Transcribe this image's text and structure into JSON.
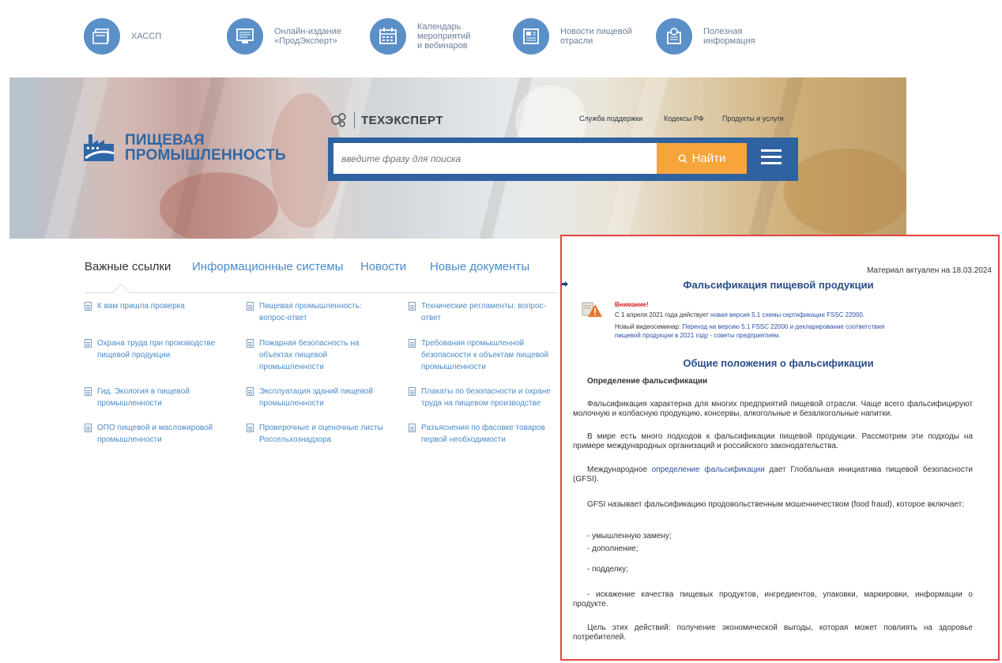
{
  "topnav": {
    "items": [
      {
        "label": "ХАССП",
        "icon": "folders-icon"
      },
      {
        "label": "Онлайн-издание\n«ПродЭксперт»",
        "icon": "monitor-icon"
      },
      {
        "label": "Календарь\nмероприятий\nи вебинаров",
        "icon": "calendar-icon"
      },
      {
        "label": "Новости пищевой\nотрасли",
        "icon": "newspaper-icon"
      },
      {
        "label": "Полезная\nинформация",
        "icon": "info-icon"
      }
    ]
  },
  "banner": {
    "logo_line1": "ПИЩЕВАЯ",
    "logo_line2": "ПРОМЫШЛЕННОСТЬ",
    "techexpert": "ТЕХЭКСПЕРТ",
    "links": [
      "Служба поддержки",
      "Кодексы РФ",
      "Продукты и услуги"
    ],
    "search_placeholder": "введите фразу для поиска",
    "search_button": "Найти"
  },
  "tabs": [
    "Важные ссылки",
    "Информационные системы",
    "Новости",
    "Новые документы"
  ],
  "links": [
    [
      "К вам пришла проверка",
      "Пищевая промышленность:\nвопрос-ответ",
      "Технические регламенты: вопрос-\nответ"
    ],
    [
      "Охрана труда при производстве\nпищевой продукции",
      "Пожарная безопасность на\nобъектах пищевой\nпромышленности",
      "Требования промышленной\nбезопасности к объектам пищевой\nпромышленности"
    ],
    [
      "Гид. Экология в пищевой\nпромышленности",
      "Эксплуатация зданий пищевой\nпромышленности",
      "Плакаты по безопасности и охране\nтруда на пищевом производстве"
    ],
    [
      "ОПО пищевой и масложировой\nпромышленности",
      "Проверочные и оценочные листы\nРоссельхознадзора",
      "Разъяснения по фасовке товаров\nпервой необходимости"
    ]
  ],
  "doc": {
    "actual": "Материал актуален на 18.03.2024",
    "title": "Фальсификация пищевой продукции",
    "attention": "Внимание!",
    "note1_prefix": "С 1 апреля 2021 года действует ",
    "note1_link": "новая версия 5.1 схемы сертификации FSSC 22000.",
    "note2_prefix": "Новый видеосеминар: ",
    "note2_link_a": "Переход на версию 5.1 FSSC 22000 и декларирование соответствия",
    "note2_link_b": "пищевой продукции в 2021 году - советы предприятиям.",
    "section": "Общие положения о фальсификации",
    "subhead": "Определение фальсификации",
    "p1": "Фальсификация характерна для многих предприятий пищевой отрасли. Чаще всего фальсифицируют молочную и колбасную продукцию, консервы, алкогольные и безалкогольные напитки.",
    "p2": "В мире есть много подходов к фальсификации пищевой продукции. Рассмотрим эти подходы на примере международных организаций и российского законодательства.",
    "p3_a": "Международное ",
    "p3_link": "определение фальсификации",
    "p3_b": " дает Глобальная инициатива пищевой безопасности (GFSI).",
    "p4": "GFSI называет фальсификацию продовольственным мошенничеством (food fraud), которое включает:",
    "b1": "- умышленную замену;",
    "b2": "- дополнение;",
    "b3": "- подделку;",
    "b4": "- искажение качества пищевых продуктов, ингредиентов, упаковки, маркировки, информации о продукте.",
    "p5": "Цель этих действий: получение экономической выгоды, которая может повлиять на здоровье потребителей."
  }
}
